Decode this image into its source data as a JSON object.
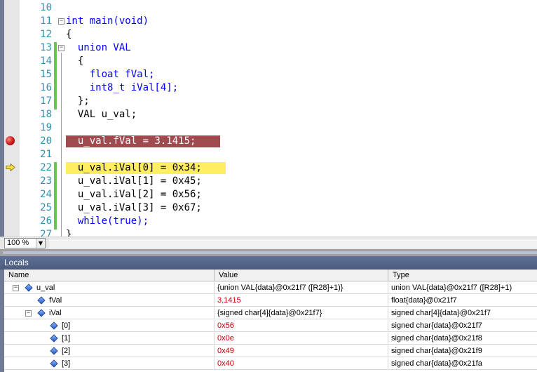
{
  "editor": {
    "lines": [
      {
        "num": "10",
        "code": ""
      },
      {
        "num": "11",
        "code": "int main(void)"
      },
      {
        "num": "12",
        "code": "{"
      },
      {
        "num": "13",
        "code": "  union VAL"
      },
      {
        "num": "14",
        "code": "  {"
      },
      {
        "num": "15",
        "code": "    float fVal;"
      },
      {
        "num": "16",
        "code": "    int8_t iVal[4];"
      },
      {
        "num": "17",
        "code": "  };"
      },
      {
        "num": "18",
        "code": "  VAL u_val;"
      },
      {
        "num": "19",
        "code": ""
      },
      {
        "num": "20",
        "code": "  u_val.fVal = 3.1415;"
      },
      {
        "num": "21",
        "code": ""
      },
      {
        "num": "22",
        "code": "  u_val.iVal[0] = 0x34;"
      },
      {
        "num": "23",
        "code": "  u_val.iVal[1] = 0x45;"
      },
      {
        "num": "24",
        "code": "  u_val.iVal[2] = 0x56;"
      },
      {
        "num": "25",
        "code": "  u_val.iVal[3] = 0x67;"
      },
      {
        "num": "26",
        "code": "  while(true);"
      },
      {
        "num": "27",
        "code": "}"
      }
    ],
    "zoom": "100 %"
  },
  "locals": {
    "title": "Locals",
    "columns": {
      "name": "Name",
      "value": "Value",
      "type": "Type"
    },
    "rows": [
      {
        "name": "u_val",
        "value": "{union VAL{data}@0x21f7 ([R28]+1)}",
        "type": "union VAL{data}@0x21f7 ([R28]+1)"
      },
      {
        "name": "fVal",
        "value": "3,1415",
        "type": "float{data}@0x21f7"
      },
      {
        "name": "iVal",
        "value": "{signed char[4]{data}@0x21f7}",
        "type": "signed char[4]{data}@0x21f7"
      },
      {
        "name": "[0]",
        "value": "0x56",
        "type": "signed char{data}@0x21f7"
      },
      {
        "name": "[1]",
        "value": "0x0e",
        "type": "signed char{data}@0x21f8"
      },
      {
        "name": "[2]",
        "value": "0x49",
        "type": "signed char{data}@0x21f9"
      },
      {
        "name": "[3]",
        "value": "0x40",
        "type": "signed char{data}@0x21fa"
      }
    ]
  },
  "colors": {
    "breakpoint_line": "#a0494f",
    "current_line": "#ffee62",
    "keyword": "#0000ff",
    "changed_value": "#c00000",
    "panel_title": "#4a5b7e"
  }
}
